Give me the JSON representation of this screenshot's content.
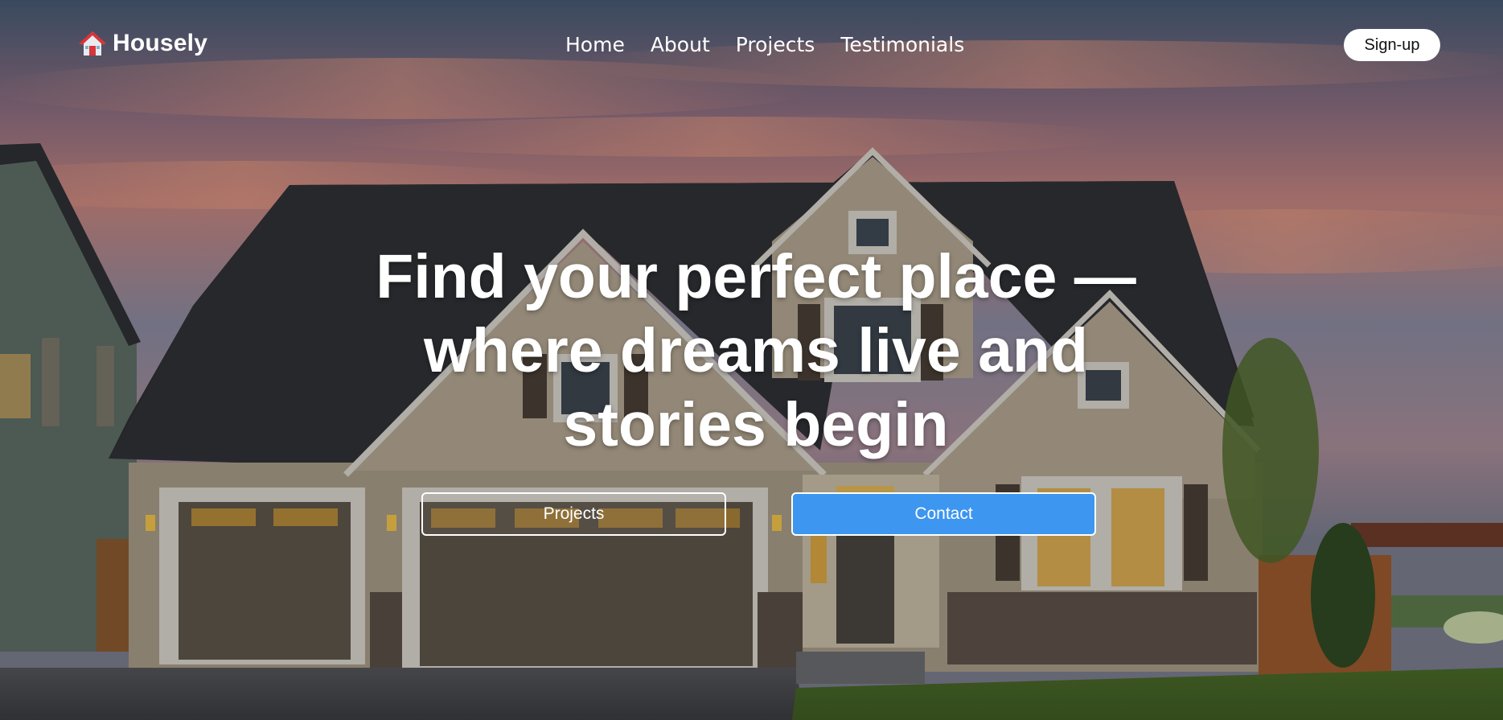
{
  "brand": {
    "name": "Housely",
    "icon": "house-icon"
  },
  "nav": {
    "items": [
      {
        "label": "Home"
      },
      {
        "label": "About"
      },
      {
        "label": "Projects"
      },
      {
        "label": "Testimonials"
      }
    ],
    "signup_label": "Sign-up"
  },
  "hero": {
    "headline": "Find your perfect place — where dreams live and stories begin",
    "projects_button": "Projects",
    "contact_button": "Contact"
  },
  "colors": {
    "accent": "#3d96ef",
    "text_on_hero": "#ffffff"
  }
}
